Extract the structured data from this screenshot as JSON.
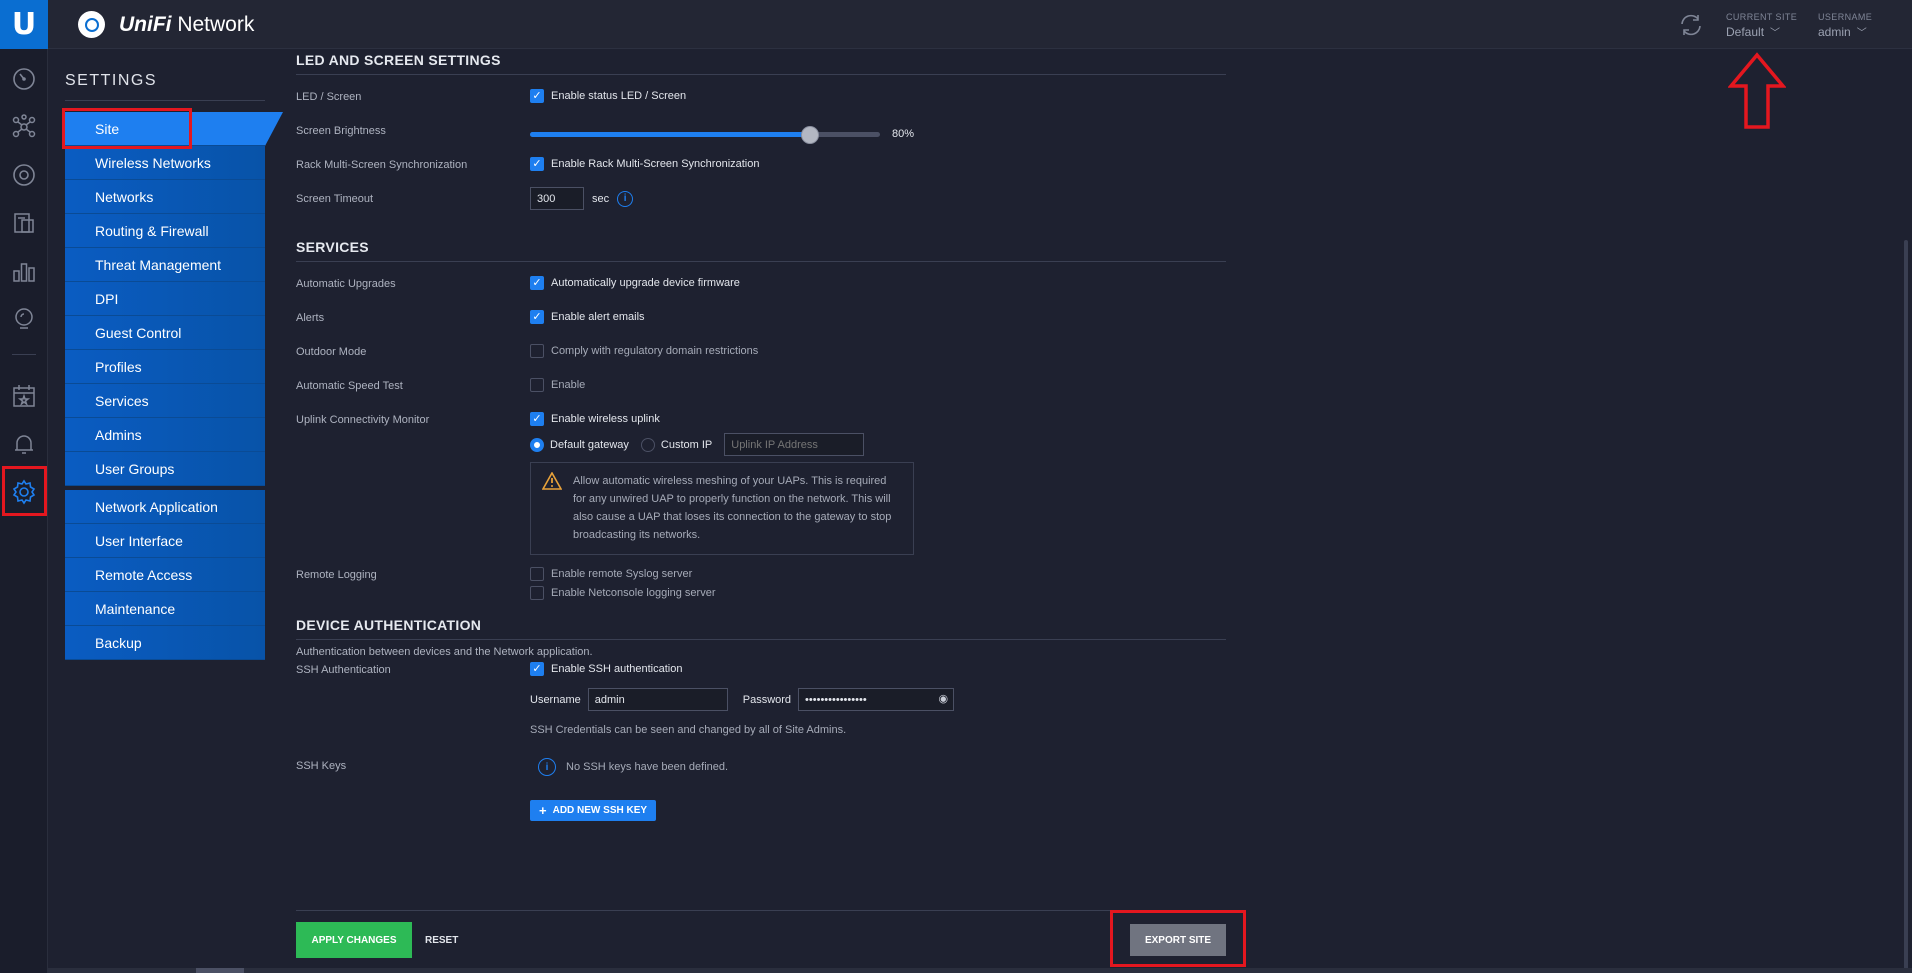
{
  "header": {
    "brand_bold": "UniFi",
    "brand_rest": " Network",
    "current_site_label": "CURRENT SITE",
    "current_site": "Default",
    "username_label": "USERNAME",
    "username": "admin"
  },
  "rail": {
    "logo": "U",
    "icons": [
      "dashboard-icon",
      "topology-icon",
      "devices-icon",
      "clients-icon",
      "statistics-icon",
      "insights-icon",
      "events-icon",
      "alerts-icon",
      "settings-icon"
    ]
  },
  "settings": {
    "title": "SETTINGS",
    "nav_group1": [
      "Site",
      "Wireless Networks",
      "Networks",
      "Routing & Firewall",
      "Threat Management",
      "DPI",
      "Guest Control",
      "Profiles",
      "Services",
      "Admins",
      "User Groups"
    ],
    "nav_group2": [
      "Network Application",
      "User Interface",
      "Remote Access",
      "Maintenance",
      "Backup"
    ]
  },
  "led": {
    "title": "LED AND SCREEN SETTINGS",
    "led_label": "LED / Screen",
    "led_cb": "Enable status LED / Screen",
    "brightness_label": "Screen Brightness",
    "brightness_value": 80,
    "brightness_text": "80%",
    "rack_label": "Rack Multi-Screen Synchronization",
    "rack_cb": "Enable Rack Multi-Screen Synchronization",
    "timeout_label": "Screen Timeout",
    "timeout_value": "300",
    "timeout_unit": "sec"
  },
  "services": {
    "title": "SERVICES",
    "upgrades_label": "Automatic Upgrades",
    "upgrades_cb": "Automatically upgrade device firmware",
    "alerts_label": "Alerts",
    "alerts_cb": "Enable alert emails",
    "outdoor_label": "Outdoor Mode",
    "outdoor_cb": "Comply with regulatory domain restrictions",
    "speed_label": "Automatic Speed Test",
    "speed_cb": "Enable",
    "uplink_label": "Uplink Connectivity Monitor",
    "uplink_cb": "Enable wireless uplink",
    "radio_default": "Default gateway",
    "radio_custom": "Custom IP",
    "uplink_placeholder": "Uplink IP Address",
    "warning": "Allow automatic wireless meshing of your UAPs. This is required for any unwired UAP to properly function on the network. This will also cause a UAP that loses its connection to the gateway to stop broadcasting its networks.",
    "logging_label": "Remote Logging",
    "syslog_cb": "Enable remote Syslog server",
    "netconsole_cb": "Enable Netconsole logging server"
  },
  "auth": {
    "title": "DEVICE AUTHENTICATION",
    "subtitle": "Authentication between devices and the Network application.",
    "ssh_label": "SSH Authentication",
    "ssh_cb": "Enable SSH authentication",
    "username_label": "Username",
    "username_value": "admin",
    "password_label": "Password",
    "password_value": "••••••••••••••••",
    "note": "SSH Credentials can be seen and changed by all of Site Admins.",
    "keys_label": "SSH Keys",
    "no_keys": "No SSH keys have been defined.",
    "add_key": "ADD NEW SSH KEY"
  },
  "footer": {
    "apply": "APPLY CHANGES",
    "reset": "RESET",
    "export": "EXPORT SITE"
  },
  "colors": {
    "accent": "#1e7ff0",
    "apply": "#2dba56",
    "highlight": "#e4171f"
  }
}
